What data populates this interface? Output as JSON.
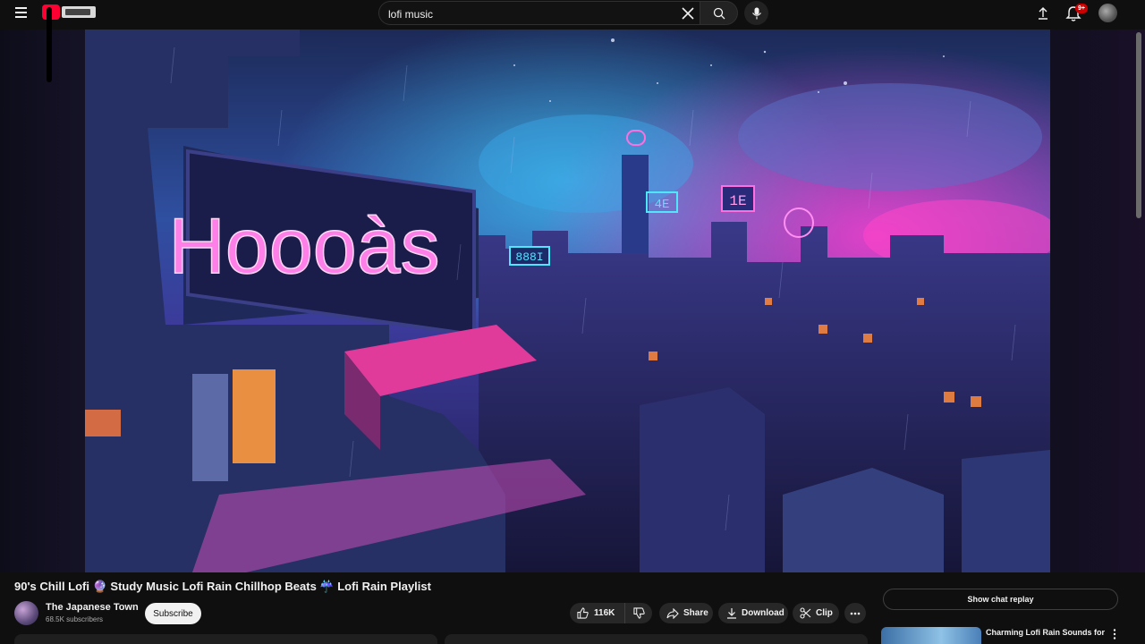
{
  "header": {
    "search": {
      "value": "lofi music",
      "placeholder": "Search"
    },
    "notifications": {
      "count": "9+"
    },
    "icons": {
      "menu": "hamburger-menu-icon",
      "logo": "youtube-logo",
      "clear": "close-icon",
      "search": "search-icon",
      "mic": "microphone-icon",
      "upload": "upload-icon",
      "bell": "bell-icon"
    }
  },
  "video": {
    "title": "90's Chill Lofi 🔮 Study Music Lofi Rain Chillhop Beats ☔ Lofi Rain Playlist",
    "neon_sign": "Hoooàs",
    "building_sign_1": "888I",
    "building_sign_2": "1E",
    "tower_sign": "4E"
  },
  "channel": {
    "name": "The Japanese Town",
    "subscribers": "68.5K subscribers",
    "subscribe_label": "Subscribe"
  },
  "actions": {
    "likes": "116K",
    "share_label": "Share",
    "download_label": "Download",
    "clip_label": "Clip"
  },
  "sidebar": {
    "chat_replay_label": "Show chat replay",
    "recommendations": [
      {
        "title": "Charming Lofi Rain Sounds for"
      }
    ]
  },
  "colors": {
    "background": "#0f0f0f",
    "brand_red": "#ff0033",
    "neon_pink": "#ff4fd8",
    "neon_cyan": "#4fe6ff"
  }
}
